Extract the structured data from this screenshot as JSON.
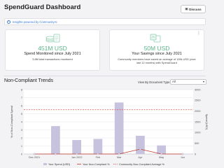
{
  "header": {
    "title": "SpendGuard Dashboard",
    "discuss_label": "Discuss"
  },
  "banner": {
    "text": "Insights powered by CommunityAI"
  },
  "cards": [
    {
      "value": "451M USD",
      "label": "Spend Monitored since July 2021",
      "sub": "3.8M total transactions monitored"
    },
    {
      "value": "50M USD",
      "label": "Your Savings since July 2021",
      "sub": "Community members have saved an average of 128k USD (over last 12 months) with SpendGuard"
    }
  ],
  "trends": {
    "title": "Non-Compliant Trends",
    "view_by_label": "View By Document Type:",
    "view_by_value": "All"
  },
  "colors": {
    "accent": "#5bb48b",
    "bar": "#c7c2dd",
    "your_line": "#c0392b",
    "community_line": "#d9534f",
    "link": "#3a7bd5"
  },
  "chart_data": {
    "type": "bar",
    "categories": [
      "Dec 2021",
      "Jan 2022",
      "Feb",
      "Mar",
      "Apr",
      "May",
      "Jun"
    ],
    "x_tick_labels": [
      "Dec 2021",
      "",
      "Jan 2022",
      "Feb",
      "Mar",
      "Apr",
      "May",
      "Jun"
    ],
    "series": [
      {
        "name": "Your Spend (USD)",
        "type": "bar",
        "axis": "right",
        "values": [
          0,
          1300,
          650,
          700,
          2400,
          850,
          400,
          0
        ]
      },
      {
        "name": "Your Non-Compliant %",
        "type": "line",
        "axis": "left",
        "values": [
          0,
          0,
          0,
          0,
          0,
          0.6,
          0,
          0
        ]
      },
      {
        "name": "Community Non-Compliant Average %",
        "type": "line",
        "axis": "left",
        "dashed": true,
        "values": [
          5.5,
          5.5,
          5.5,
          5.5,
          5.5,
          5.5,
          5.5,
          5.5
        ]
      }
    ],
    "ylabel_left": "% of Non-Compliant Spend",
    "ylabel_right": "Spend (USD)",
    "ylim_left": [
      0,
      8
    ],
    "ylim_right": [
      0,
      3000
    ],
    "yticks_left": [
      "0",
      "1",
      "2",
      "3",
      "4",
      "5",
      "6",
      "7",
      "8"
    ],
    "yticks_right": [
      "0",
      "500",
      "1000",
      "1500",
      "2000",
      "2500",
      "3000"
    ],
    "grid": true,
    "legend_position": "bottom"
  }
}
